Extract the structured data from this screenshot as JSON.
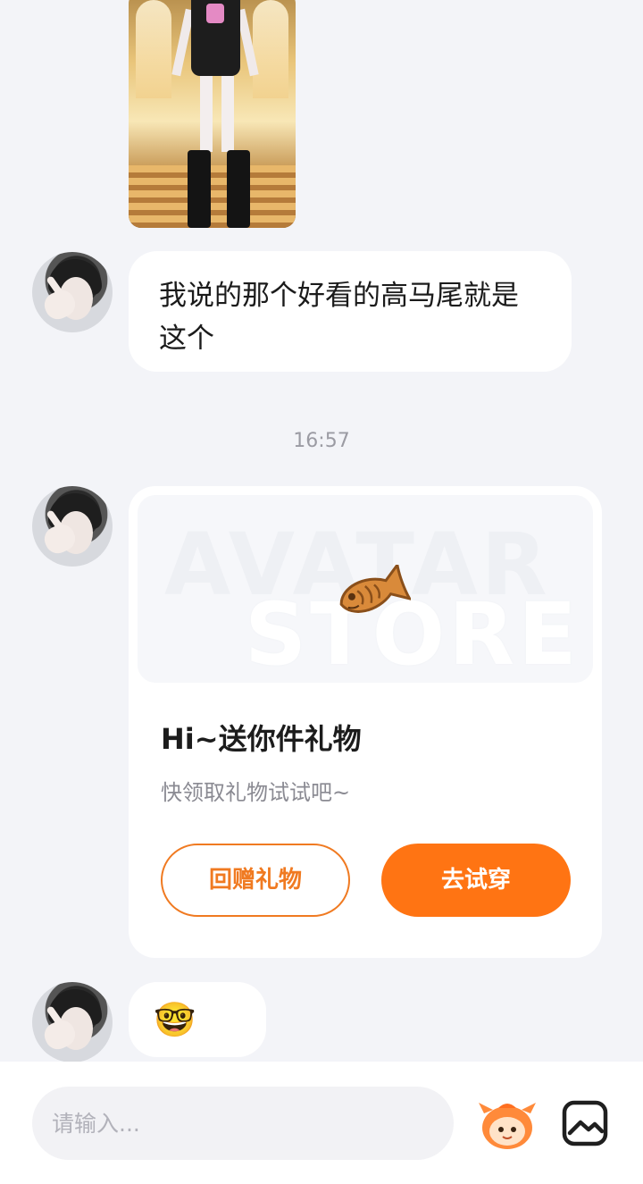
{
  "messages": {
    "text_message": "我说的那个好看的高马尾就是这个",
    "timestamp": "16:57",
    "emoji_message": "🤓🤓"
  },
  "gift_card": {
    "banner_watermark_line1": "AVATAR",
    "banner_watermark_line2": "STORE",
    "banner_icon": "taiyaki-fish-icon",
    "title": "Hi~送你件礼物",
    "subtitle": "快领取礼物试试吧~",
    "return_gift_button": "回赠礼物",
    "try_on_button": "去试穿"
  },
  "composer": {
    "placeholder": "请输入...",
    "mascot_icon": "mascot-icon",
    "gallery_icon": "image-icon"
  },
  "colors": {
    "background": "#f3f4f8",
    "accent": "#ff7413",
    "bubble": "#ffffff",
    "timestamp": "#9b9ba3"
  }
}
